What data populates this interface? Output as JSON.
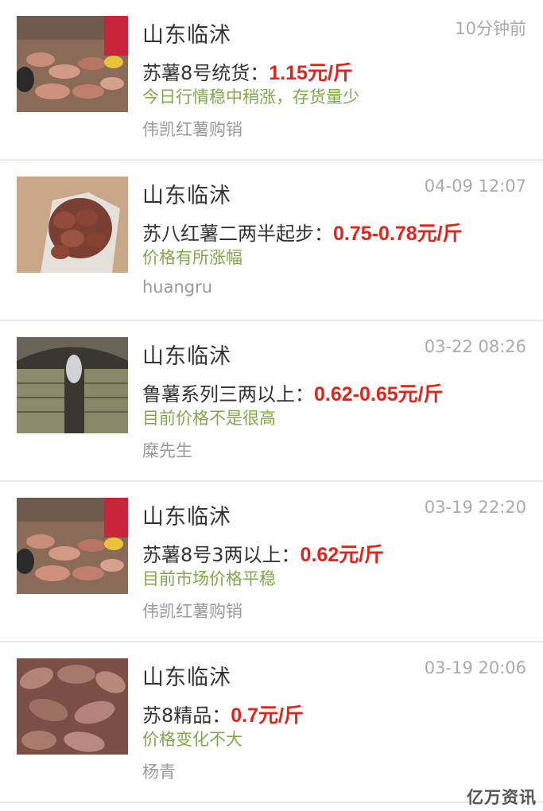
{
  "listings": [
    {
      "region": "山东临沭",
      "time": "10分钟前",
      "title": "苏薯8号统货：",
      "price": "1.15元/斤",
      "note": "今日行情稳中稍涨，存货量少",
      "seller": "伟凯红薯购销",
      "thumb_icon": "sweet-potato-pile-photo"
    },
    {
      "region": "山东临沭",
      "time": "04-09 12:07",
      "title": "苏八红薯二两半起步：",
      "price": "0.75-0.78元/斤",
      "note": "价格有所涨幅",
      "seller": "huangru",
      "thumb_icon": "sweet-potato-sack-photo"
    },
    {
      "region": "山东临沭",
      "time": "03-22 08:26",
      "title": "鲁薯系列三两以上：",
      "price": "0.62-0.65元/斤",
      "note": "目前价格不是很高",
      "seller": "糜先生",
      "thumb_icon": "storage-cellar-photo"
    },
    {
      "region": "山东临沭",
      "time": "03-19 22:20",
      "title": "苏薯8号3两以上：",
      "price": "0.62元/斤",
      "note": "目前市场价格平稳",
      "seller": "伟凯红薯购销",
      "thumb_icon": "sweet-potato-pile-photo"
    },
    {
      "region": "山东临沭",
      "time": "03-19 20:06",
      "title": "苏8精品：",
      "price": "0.7元/斤",
      "note": "价格变化不大",
      "seller": "杨青",
      "thumb_icon": "sweet-potato-closeup-photo"
    }
  ],
  "watermark": "亿万资讯",
  "colors": {
    "price": "#e0241b",
    "note": "#7fa84a",
    "seller": "#9a9a9a",
    "time": "#aaaaaa",
    "divider": "#e9e9e9"
  }
}
